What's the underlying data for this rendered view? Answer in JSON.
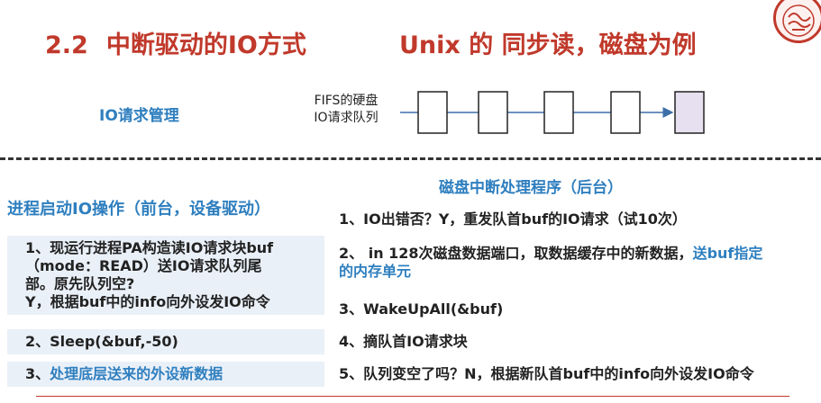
{
  "title": {
    "number": "2.2",
    "main": "中断驱动的IO方式",
    "sub": "Unix 的 同步读，磁盘为例"
  },
  "queue": {
    "label": "IO请求管理",
    "fifs_line1": "FIFS的硬盘",
    "fifs_line2": "IO请求队列"
  },
  "left": {
    "heading": "进程启动IO操作（前台，设备驱动）",
    "steps": [
      {
        "line1": "1、现运行进程PA构造读IO请求块buf",
        "line2": "（mode：READ）送IO请求队列尾",
        "line3": "部。原先队列空?",
        "line4": "Y，根据buf中的info向外设发IO命令"
      },
      {
        "text": "2、Sleep(&buf,-50)"
      },
      {
        "prefix": "3、",
        "text": "处理底层送来的外设新数据"
      }
    ]
  },
  "right": {
    "heading": "磁盘中断处理程序（后台）",
    "steps": [
      {
        "text": "1、IO出错否？Y，重发队首buf的IO请求（试10次）"
      },
      {
        "prefix": "2、  in 128次磁盘数据端口，取数据缓存中的新数据，",
        "highlight1": "送buf指定",
        "highlight2": "的内存单元"
      },
      {
        "text": "3、WakeUpAll(&buf)"
      },
      {
        "text": "4、摘队首IO请求块"
      },
      {
        "text": "5、队列变空了吗？N，根据新队首buf中的info向外设发IO命令"
      }
    ]
  },
  "colors": {
    "title": "#c0392b",
    "heading": "#2f7fbf",
    "step_bg": "#eaf0f8",
    "queue_last_fill": "#e6e0f0"
  }
}
